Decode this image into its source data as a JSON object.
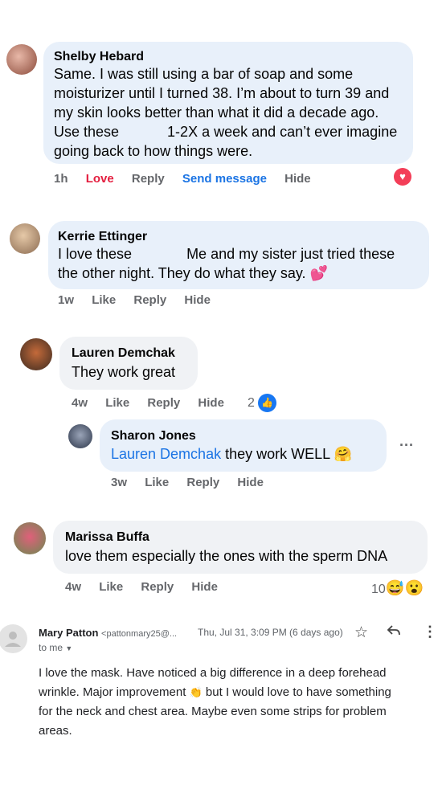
{
  "comments": [
    {
      "author": "Shelby Hebard",
      "text_lines": [
        "Same. I was still using a bar of soap and some",
        "moisturizer until I turned 38. I’m about to turn 39 and",
        "my skin looks better than what it did a decade ago.",
        "Use these",
        "1-2X a week and can’t ever imagine",
        "going back to how things were."
      ],
      "time": "1h",
      "love_label": "Love",
      "reply_label": "Reply",
      "send_message_label": "Send message",
      "hide_label": "Hide"
    },
    {
      "author": "Kerrie Ettinger",
      "text_line1_a": "I love these",
      "text_line1_b": "Me and my sister just tried these",
      "text_line2": "the other night. They do what they say.",
      "emoji": "💕",
      "time": "1w",
      "like_label": "Like",
      "reply_label": "Reply",
      "hide_label": "Hide"
    },
    {
      "author": "Lauren Demchak",
      "text": "They work great",
      "time": "4w",
      "like_label": "Like",
      "reply_label": "Reply",
      "hide_label": "Hide",
      "reaction_count": "2"
    },
    {
      "author": "Sharon Jones",
      "mention": "Lauren Demchak",
      "text": "they work WELL",
      "emoji": "🤗",
      "time": "3w",
      "like_label": "Like",
      "reply_label": "Reply",
      "hide_label": "Hide",
      "more": "···"
    },
    {
      "author": "Marissa Buffa",
      "text": "love them especially the ones with the sperm DNA",
      "time": "4w",
      "like_label": "Like",
      "reply_label": "Reply",
      "hide_label": "Hide",
      "reaction_count": "10",
      "reaction_emojis": "😅😮"
    }
  ],
  "email": {
    "sender": "Mary Patton",
    "sender_email": "<pattonmary25@...",
    "date": "Thu, Jul 31, 3:09 PM (6 days ago)",
    "to": "to me",
    "body_lines": [
      "I love the mask. Have noticed a big difference in a deep forehead",
      "wrinkle.  Major improvement",
      "but I would love to have something",
      "for the neck and chest area. Maybe even some strips for problem",
      "areas."
    ],
    "clap_emoji": "👏"
  },
  "colors": {
    "bubble": "#e8f0fa",
    "bubble_gray": "#f0f2f5",
    "love": "#e41e3f",
    "link": "#1b74e4",
    "meta": "#65676b"
  }
}
